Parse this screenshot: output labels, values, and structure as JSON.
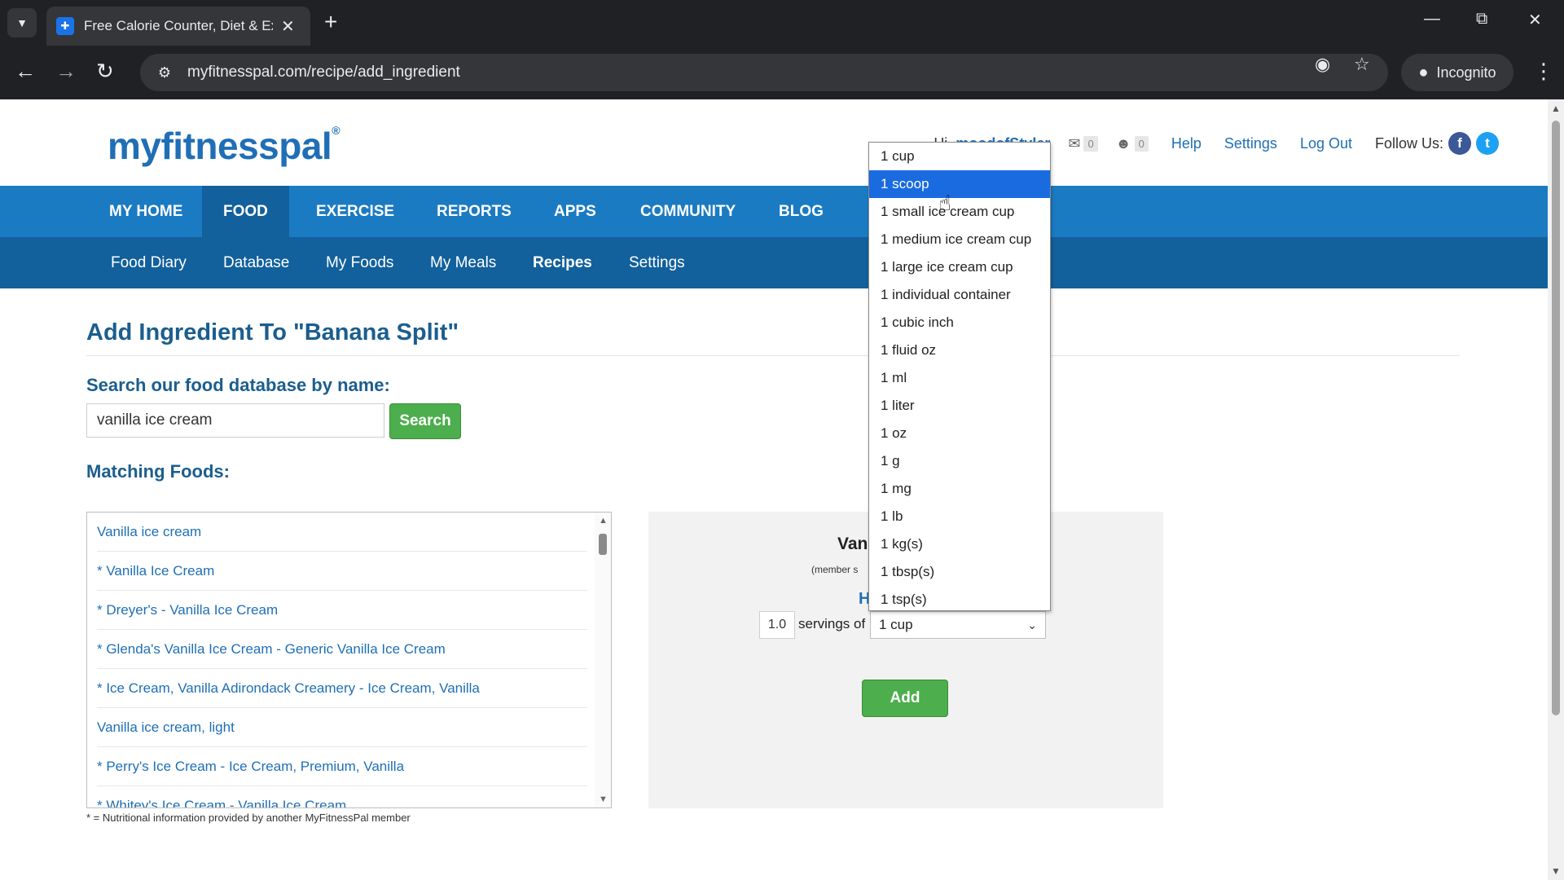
{
  "browser": {
    "tab_title": "Free Calorie Counter, Diet & Ex",
    "url": "myfitnesspal.com/recipe/add_ingredient",
    "incognito_label": "Incognito"
  },
  "site": {
    "logo": "myfitnesspal",
    "greeting_prefix": "Hi,",
    "username": "moodofStyler",
    "messages_count": "0",
    "friends_count": "0",
    "help": "Help",
    "settings": "Settings",
    "logout": "Log Out",
    "follow_us": "Follow Us:"
  },
  "main_nav": [
    "MY HOME",
    "FOOD",
    "EXERCISE",
    "REPORTS",
    "APPS",
    "COMMUNITY",
    "BLOG"
  ],
  "sub_nav": [
    "Food Diary",
    "Database",
    "My Foods",
    "My Meals",
    "Recipes",
    "Settings"
  ],
  "content": {
    "heading": "Add Ingredient To \"Banana Split\"",
    "search_label": "Search our food database by name:",
    "search_value": "vanilla ice cream",
    "search_button": "Search",
    "matching_label": "Matching Foods:",
    "foods": [
      "Vanilla ice cream",
      "* Vanilla Ice Cream",
      "* Dreyer's - Vanilla Ice Cream",
      "* Glenda's Vanilla Ice Cream - Generic Vanilla Ice Cream",
      "* Ice Cream, Vanilla Adirondack Creamery - Ice Cream, Vanilla",
      "Vanilla ice cream, light",
      "* Perry's Ice Cream - Ice Cream, Premium, Vanilla",
      "* Whitey's Ice Cream - Vanilla Ice Cream"
    ],
    "footnote": "* = Nutritional information provided by another MyFitnessPal member"
  },
  "detail": {
    "name_partial": "Van",
    "member_partial": "(member s",
    "h_partial": "H",
    "servings_value": "1.0",
    "servings_of": "servings of",
    "selected_unit": "1 cup",
    "add_button": "Add"
  },
  "dropdown": {
    "options": [
      "1 cup",
      "1 scoop",
      "1 small ice cream cup",
      "1 medium ice cream cup",
      "1 large ice cream cup",
      "1 individual container",
      "1 cubic inch",
      "1 fluid oz",
      "1 ml",
      "1 liter",
      "1 oz",
      "1 g",
      "1 mg",
      "1 lb",
      "1 kg(s)",
      "1 tbsp(s)",
      "1 tsp(s)"
    ],
    "highlighted": "1 scoop"
  }
}
